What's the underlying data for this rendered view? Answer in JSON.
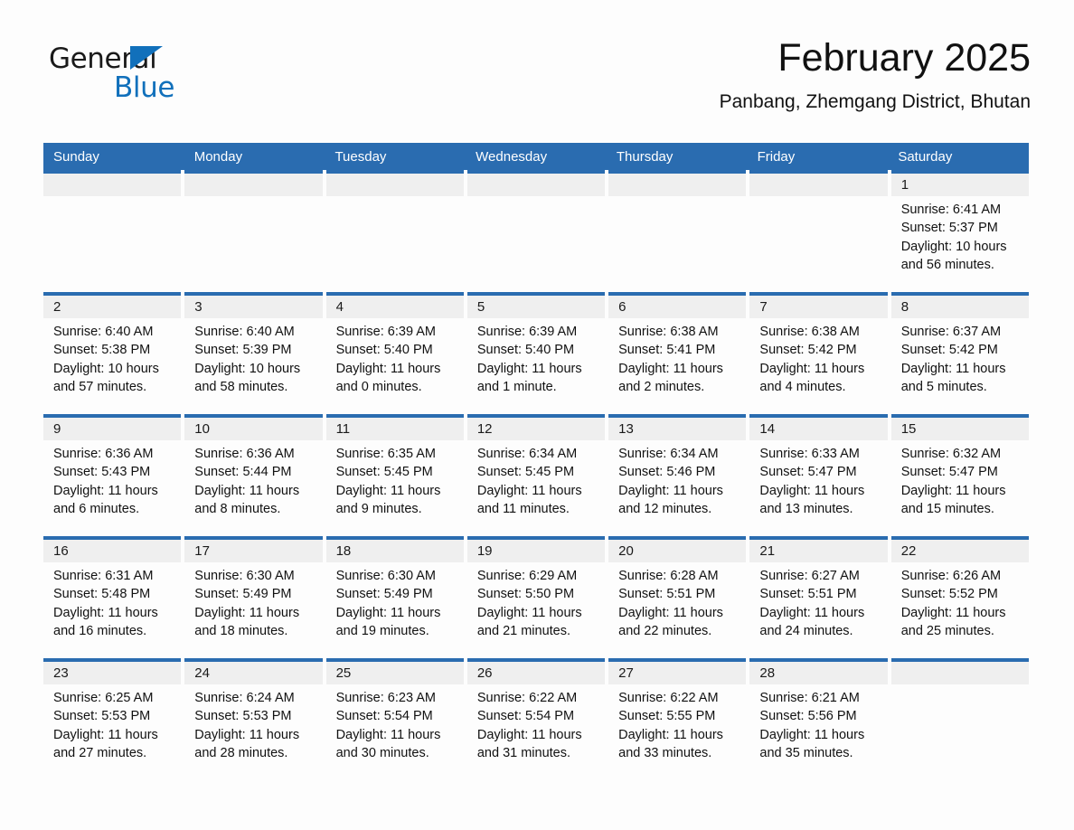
{
  "brand": {
    "name_part1": "General",
    "name_part2": "Blue",
    "triangle_icon": "triangle-icon",
    "accent_color": "#1170bb"
  },
  "header": {
    "month_title": "February 2025",
    "location": "Panbang, Zhemgang District, Bhutan"
  },
  "theme": {
    "header_blue": "#2a6cb0",
    "date_band_gray": "#efefef",
    "page_background": "#fdfdfd",
    "text_color": "#111111"
  },
  "weekdays": [
    "Sunday",
    "Monday",
    "Tuesday",
    "Wednesday",
    "Thursday",
    "Friday",
    "Saturday"
  ],
  "weeks": [
    [
      {
        "day": "",
        "info": ""
      },
      {
        "day": "",
        "info": ""
      },
      {
        "day": "",
        "info": ""
      },
      {
        "day": "",
        "info": ""
      },
      {
        "day": "",
        "info": ""
      },
      {
        "day": "",
        "info": ""
      },
      {
        "day": "1",
        "info": "Sunrise: 6:41 AM\nSunset: 5:37 PM\nDaylight: 10 hours\nand 56 minutes."
      }
    ],
    [
      {
        "day": "2",
        "info": "Sunrise: 6:40 AM\nSunset: 5:38 PM\nDaylight: 10 hours\nand 57 minutes."
      },
      {
        "day": "3",
        "info": "Sunrise: 6:40 AM\nSunset: 5:39 PM\nDaylight: 10 hours\nand 58 minutes."
      },
      {
        "day": "4",
        "info": "Sunrise: 6:39 AM\nSunset: 5:40 PM\nDaylight: 11 hours\nand 0 minutes."
      },
      {
        "day": "5",
        "info": "Sunrise: 6:39 AM\nSunset: 5:40 PM\nDaylight: 11 hours\nand 1 minute."
      },
      {
        "day": "6",
        "info": "Sunrise: 6:38 AM\nSunset: 5:41 PM\nDaylight: 11 hours\nand 2 minutes."
      },
      {
        "day": "7",
        "info": "Sunrise: 6:38 AM\nSunset: 5:42 PM\nDaylight: 11 hours\nand 4 minutes."
      },
      {
        "day": "8",
        "info": "Sunrise: 6:37 AM\nSunset: 5:42 PM\nDaylight: 11 hours\nand 5 minutes."
      }
    ],
    [
      {
        "day": "9",
        "info": "Sunrise: 6:36 AM\nSunset: 5:43 PM\nDaylight: 11 hours\nand 6 minutes."
      },
      {
        "day": "10",
        "info": "Sunrise: 6:36 AM\nSunset: 5:44 PM\nDaylight: 11 hours\nand 8 minutes."
      },
      {
        "day": "11",
        "info": "Sunrise: 6:35 AM\nSunset: 5:45 PM\nDaylight: 11 hours\nand 9 minutes."
      },
      {
        "day": "12",
        "info": "Sunrise: 6:34 AM\nSunset: 5:45 PM\nDaylight: 11 hours\nand 11 minutes."
      },
      {
        "day": "13",
        "info": "Sunrise: 6:34 AM\nSunset: 5:46 PM\nDaylight: 11 hours\nand 12 minutes."
      },
      {
        "day": "14",
        "info": "Sunrise: 6:33 AM\nSunset: 5:47 PM\nDaylight: 11 hours\nand 13 minutes."
      },
      {
        "day": "15",
        "info": "Sunrise: 6:32 AM\nSunset: 5:47 PM\nDaylight: 11 hours\nand 15 minutes."
      }
    ],
    [
      {
        "day": "16",
        "info": "Sunrise: 6:31 AM\nSunset: 5:48 PM\nDaylight: 11 hours\nand 16 minutes."
      },
      {
        "day": "17",
        "info": "Sunrise: 6:30 AM\nSunset: 5:49 PM\nDaylight: 11 hours\nand 18 minutes."
      },
      {
        "day": "18",
        "info": "Sunrise: 6:30 AM\nSunset: 5:49 PM\nDaylight: 11 hours\nand 19 minutes."
      },
      {
        "day": "19",
        "info": "Sunrise: 6:29 AM\nSunset: 5:50 PM\nDaylight: 11 hours\nand 21 minutes."
      },
      {
        "day": "20",
        "info": "Sunrise: 6:28 AM\nSunset: 5:51 PM\nDaylight: 11 hours\nand 22 minutes."
      },
      {
        "day": "21",
        "info": "Sunrise: 6:27 AM\nSunset: 5:51 PM\nDaylight: 11 hours\nand 24 minutes."
      },
      {
        "day": "22",
        "info": "Sunrise: 6:26 AM\nSunset: 5:52 PM\nDaylight: 11 hours\nand 25 minutes."
      }
    ],
    [
      {
        "day": "23",
        "info": "Sunrise: 6:25 AM\nSunset: 5:53 PM\nDaylight: 11 hours\nand 27 minutes."
      },
      {
        "day": "24",
        "info": "Sunrise: 6:24 AM\nSunset: 5:53 PM\nDaylight: 11 hours\nand 28 minutes."
      },
      {
        "day": "25",
        "info": "Sunrise: 6:23 AM\nSunset: 5:54 PM\nDaylight: 11 hours\nand 30 minutes."
      },
      {
        "day": "26",
        "info": "Sunrise: 6:22 AM\nSunset: 5:54 PM\nDaylight: 11 hours\nand 31 minutes."
      },
      {
        "day": "27",
        "info": "Sunrise: 6:22 AM\nSunset: 5:55 PM\nDaylight: 11 hours\nand 33 minutes."
      },
      {
        "day": "28",
        "info": "Sunrise: 6:21 AM\nSunset: 5:56 PM\nDaylight: 11 hours\nand 35 minutes."
      },
      {
        "day": "",
        "info": ""
      }
    ]
  ]
}
